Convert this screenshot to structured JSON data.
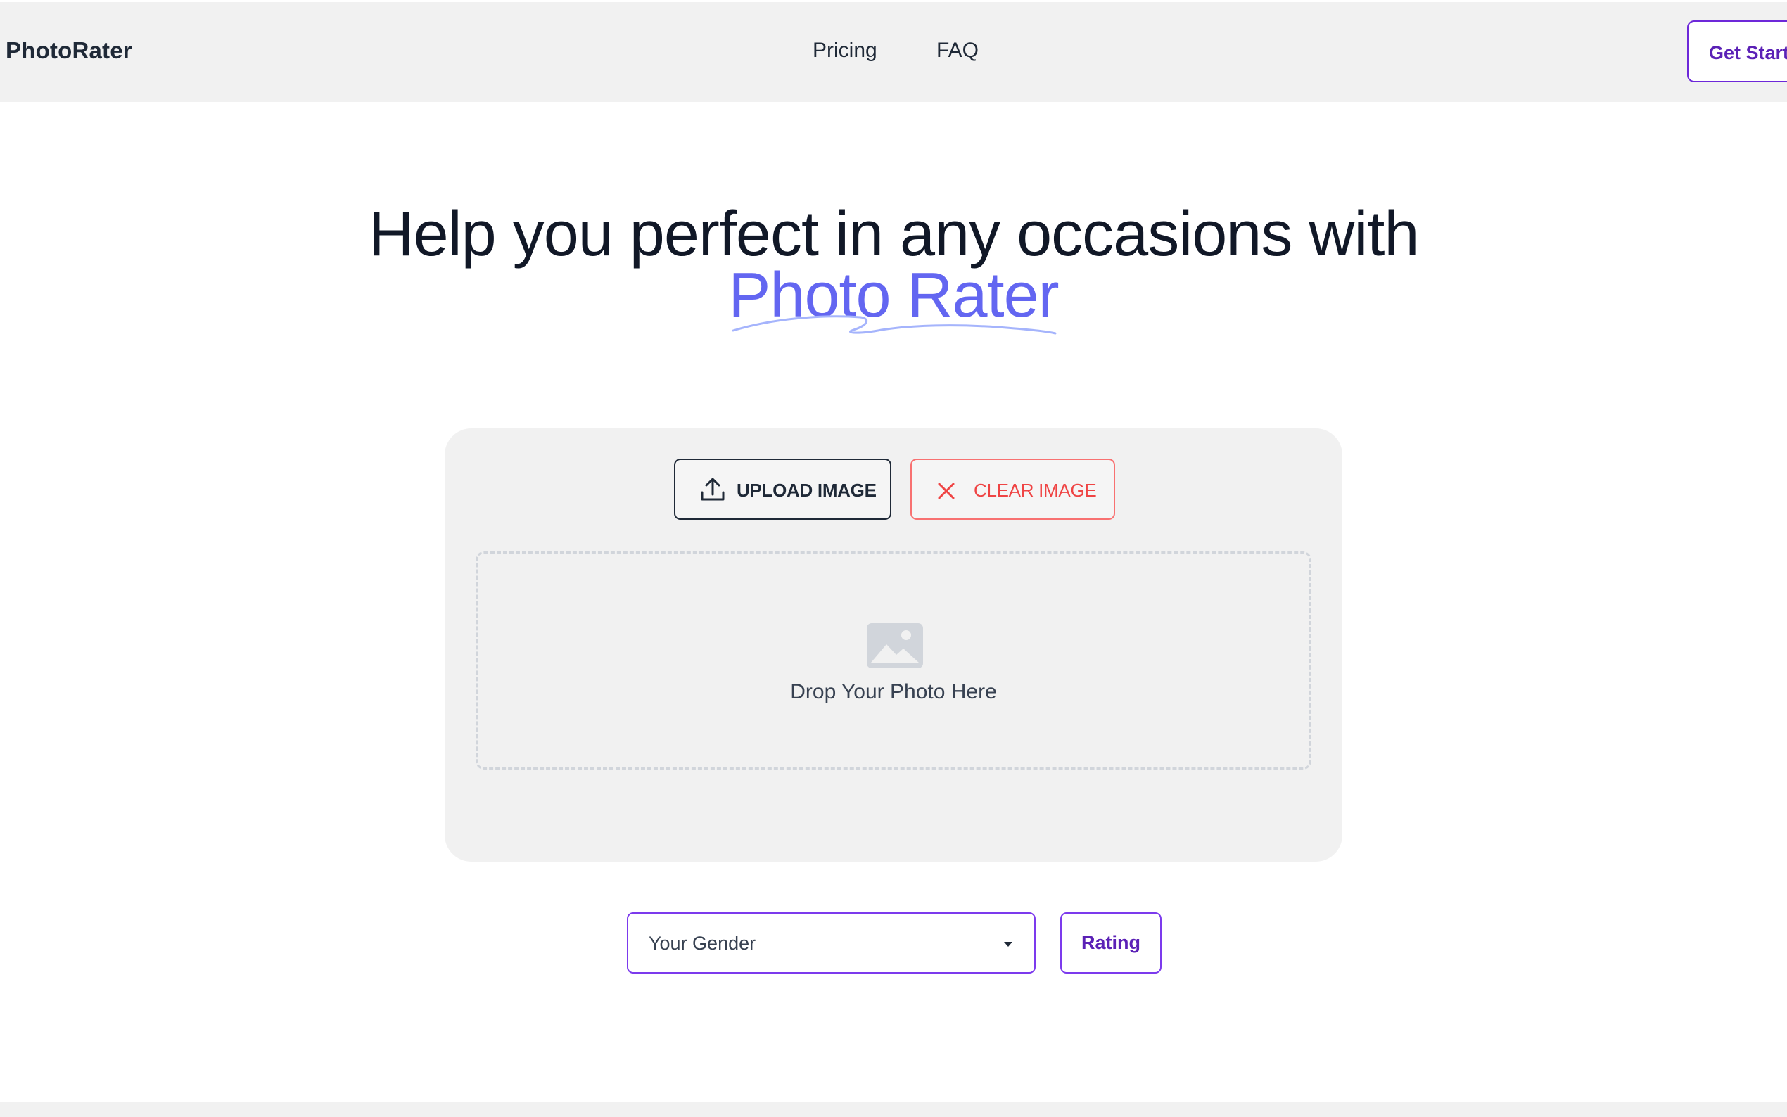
{
  "header": {
    "logo": "PhotoRater",
    "nav": [
      {
        "label": "Pricing"
      },
      {
        "label": "FAQ"
      }
    ],
    "cta_label": "Get Started"
  },
  "hero": {
    "line1": "Help you perfect in any occasions with",
    "line2": "Photo Rater",
    "accent_color": "#6366f1"
  },
  "upload": {
    "upload_label": "UPLOAD IMAGE",
    "upload_icon": "upload-icon",
    "clear_label": "CLEAR IMAGE",
    "clear_icon": "close-icon",
    "drop_text": "Drop Your Photo Here",
    "drop_icon": "image-placeholder-icon"
  },
  "controls": {
    "gender_value": "Your Gender",
    "rating_label": "Rating"
  },
  "colors": {
    "brand": "#6d28d9",
    "danger": "#ef4444",
    "panel": "#f1f1f1"
  }
}
